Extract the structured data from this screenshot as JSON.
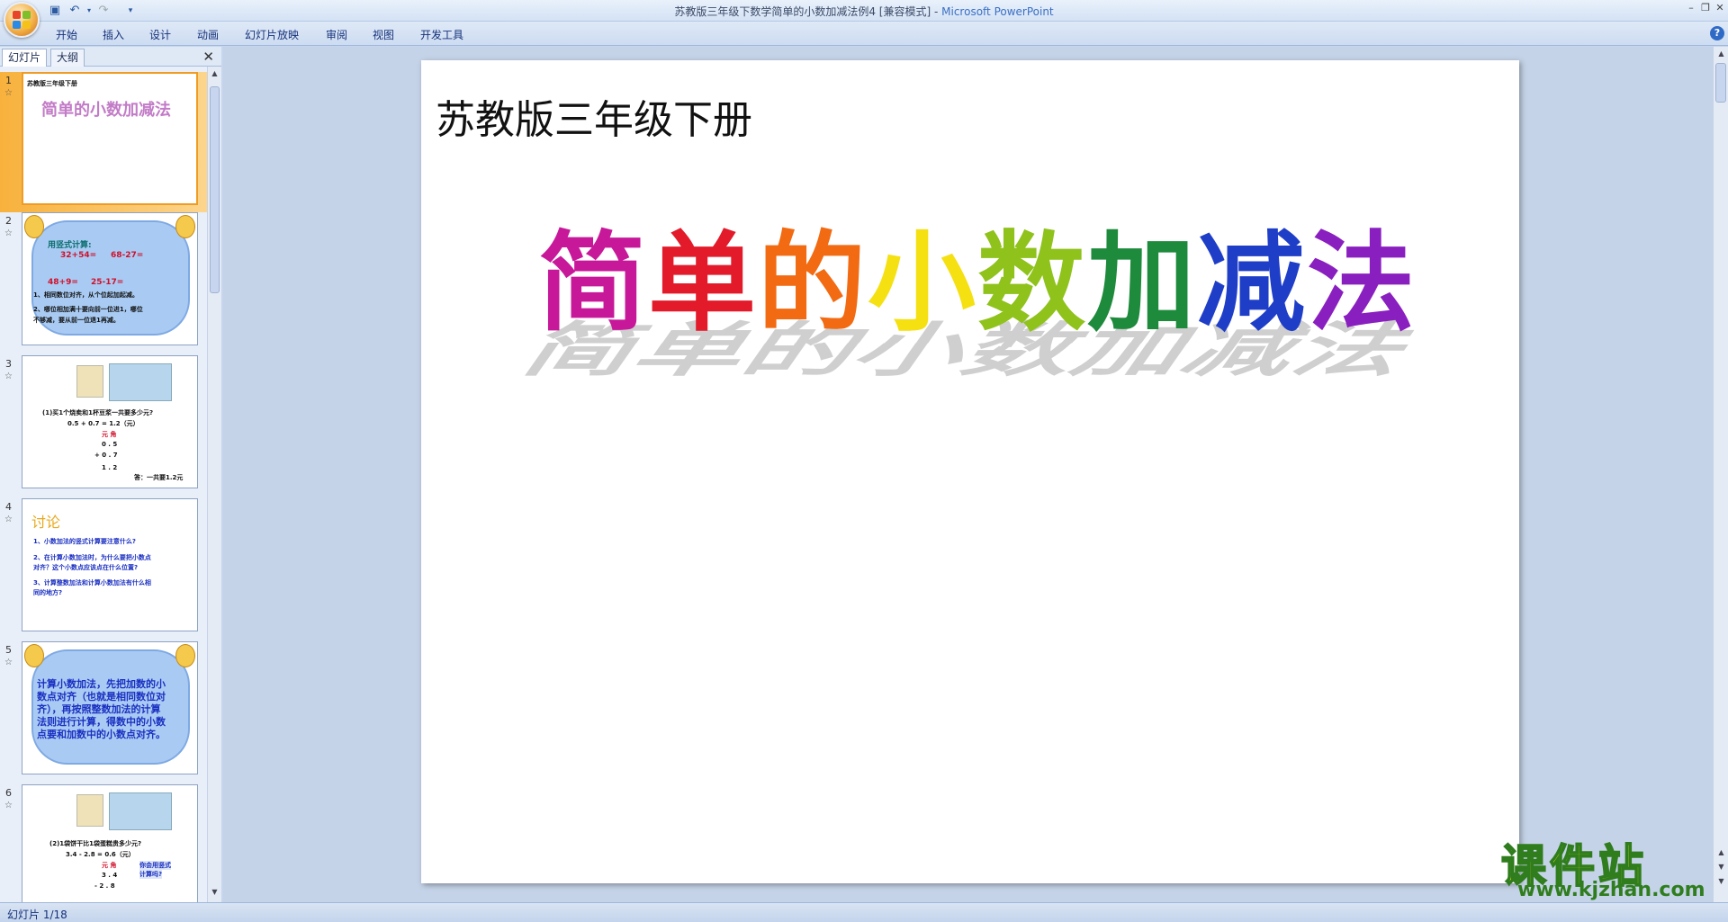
{
  "window": {
    "title": "苏教版三年级下数学简单的小数加减法例4 [兼容模式]",
    "separator": " - ",
    "app_name": "Microsoft PowerPoint"
  },
  "ribbon": {
    "tabs": [
      "开始",
      "插入",
      "设计",
      "动画",
      "幻灯片放映",
      "审阅",
      "视图",
      "开发工具"
    ]
  },
  "left_pane": {
    "tabs": [
      "幻灯片",
      "大纲"
    ],
    "thumbnails": [
      {
        "num": "1",
        "lines": [
          "苏教版三年级下册",
          "简单的小数加减法"
        ]
      },
      {
        "num": "2",
        "lines": [
          "用竖式计算:",
          "32+54=",
          "68-27=",
          "48+9=",
          "25-17=",
          "1、相同数位对齐，从个位起加起减。",
          "2、哪位相加满十要向前一位进1，哪位",
          "不够减，要从前一位退1再减。"
        ]
      },
      {
        "num": "3",
        "lines": [
          "(1)买1个烧卖和1杯豆浆一共要多少元?",
          "0.5 + 0.7 = 1.2（元）",
          "元 角",
          "0 . 5",
          "+ 0 . 7",
          "1 . 2",
          "答：一共要1.2元"
        ]
      },
      {
        "num": "4",
        "lines": [
          "讨论",
          "1、小数加法的竖式计算要注意什么?",
          "2、在计算小数加法时，为什么要把小数点",
          "对齐？这个小数点应该点在什么位置?",
          "3、计算整数加法和计算小数加法有什么相",
          "同的地方?"
        ]
      },
      {
        "num": "5",
        "lines": [
          "计算小数加法，先把加数的小",
          "数点对齐（也就是相同数位对",
          "齐），再按照整数加法的计算",
          "法则进行计算，得数中的小数",
          "点要和加数中的小数点对齐。"
        ]
      },
      {
        "num": "6",
        "lines": [
          "(2)1袋饼干比1袋蛋糕贵多少元?",
          "3.4 - 2.8 = 0.6（元）",
          "元 角",
          "3 . 4",
          "- 2 . 8",
          "你会用竖式",
          "计算吗?"
        ]
      }
    ]
  },
  "slide": {
    "subtitle": "苏教版三年级下册",
    "title_chars": [
      "简",
      "单",
      "的",
      "小",
      "数",
      "加",
      "减",
      "法"
    ],
    "title_colors": [
      "#c8189a",
      "#e21a2a",
      "#f26a12",
      "#f5e012",
      "#8fc21b",
      "#1e8a3c",
      "#1f3ec8",
      "#8a1fc0"
    ]
  },
  "status": {
    "text": "幻灯片 1/18"
  },
  "watermark": {
    "title": "课件站",
    "url": "www.kjzhan.com"
  }
}
